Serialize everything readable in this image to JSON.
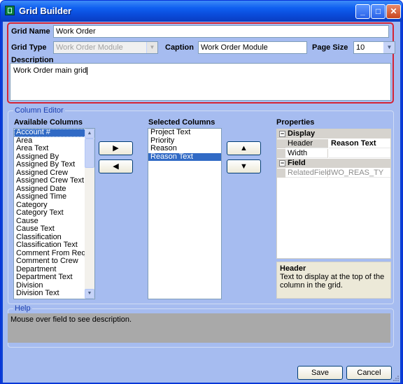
{
  "window": {
    "title": "Grid Builder",
    "min": "_",
    "max": "□",
    "close": "✕"
  },
  "grid": {
    "name_label": "Grid Name",
    "name_value": "Work Order",
    "type_label": "Grid Type",
    "type_value": "Work Order Module",
    "caption_label": "Caption",
    "caption_value": "Work Order Module",
    "pagesize_label": "Page Size",
    "pagesize_value": "10",
    "description_label": "Description",
    "description_value": "Work Order main grid"
  },
  "column_editor": {
    "legend": "Column Editor",
    "available_label": "Available Columns",
    "available": [
      "Account #",
      "Area",
      "Area Text",
      "Assigned By",
      "Assigned By Text",
      "Assigned Crew",
      "Assigned Crew Text",
      "Assigned Date",
      "Assigned Time",
      "Category",
      "Category Text",
      "Cause",
      "Cause Text",
      "Classification",
      "Classification Text",
      "Comment From Reques",
      "Comment to Crew",
      "Department",
      "Department Text",
      "Division",
      "Division Text"
    ],
    "selected_label": "Selected Columns",
    "selected": [
      "Project Text",
      "Priority",
      "Reason",
      "Reason Text"
    ],
    "add_arrow": "▶",
    "remove_arrow": "◀",
    "up_arrow": "▲",
    "down_arrow": "▼"
  },
  "properties": {
    "label": "Properties",
    "cat_display": "Display",
    "header_name": "Header",
    "header_value": "Reason Text",
    "width_name": "Width",
    "width_value": "",
    "cat_field": "Field",
    "related_name": "RelatedField",
    "related_value": "WO_REAS_TY",
    "toggle": "⊟",
    "help_title": "Header",
    "help_text": "Text to display at the top of the column in the grid."
  },
  "help": {
    "legend": "Help",
    "text": "Mouse over field to see description."
  },
  "buttons": {
    "save": "Save",
    "cancel": "Cancel"
  },
  "colors": {
    "accent": "#316ac5",
    "client_bg": "#a6bcf0",
    "highlight_border": "#d42435"
  }
}
